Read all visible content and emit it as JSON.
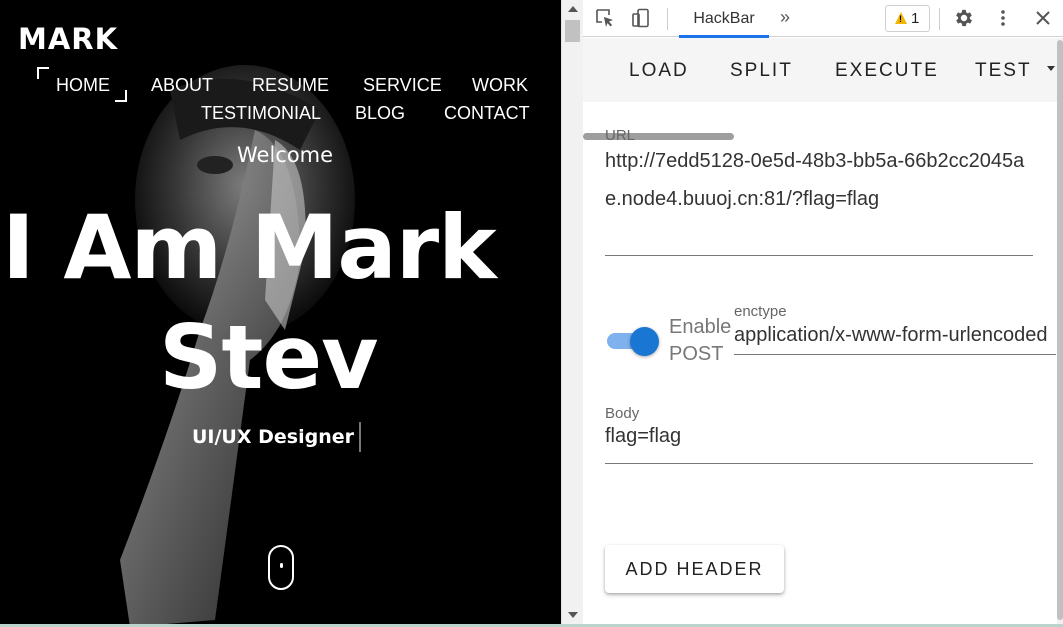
{
  "site": {
    "logo": "MARK",
    "nav": [
      "HOME",
      "ABOUT",
      "RESUME",
      "SERVICE",
      "WORK",
      "TESTIMONIAL",
      "BLOG",
      "CONTACT"
    ],
    "welcome": "Welcome",
    "hero_line1": "I Am Mark",
    "hero_line2": "Stev",
    "role": "UI/UX Designer"
  },
  "devtools": {
    "active_tab": "HackBar",
    "warning_count": "1",
    "icons": [
      "inspect-element-icon",
      "device-toolbar-icon",
      "more-tabs-icon",
      "warning-icon",
      "settings-icon",
      "more-options-icon",
      "close-icon"
    ]
  },
  "hackbar": {
    "tabs": [
      "LOAD",
      "SPLIT",
      "EXECUTE",
      "TEST"
    ],
    "url_label": "URL",
    "url_value": "http://7edd5128-0e5d-48b3-bb5a-66b2cc2045ae.node4.buuoj.cn:81/?flag=flag",
    "post_enabled": true,
    "enable_post_label": "Enable POST",
    "enctype_label": "enctype",
    "enctype_value": "application/x-www-form-urlencoded",
    "body_label": "Body",
    "body_value": "flag=flag",
    "add_header_label": "ADD HEADER"
  },
  "colors": {
    "accent": "#1976d2",
    "tab_underline": "#1a73e8",
    "warning": "#f2b600"
  }
}
